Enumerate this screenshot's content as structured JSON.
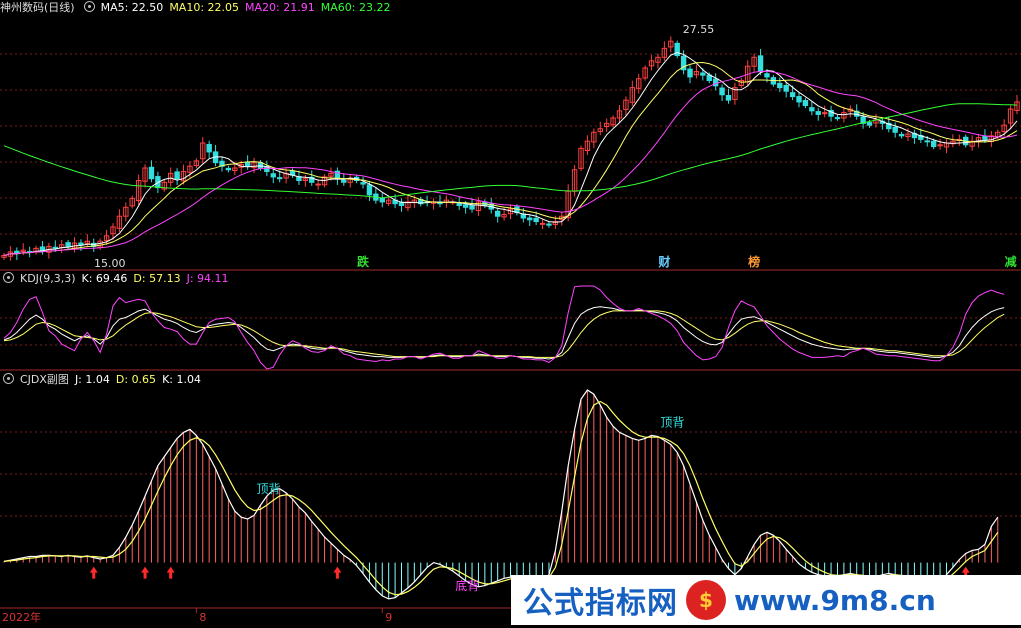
{
  "header": {
    "main": [
      {
        "text": "神州数码(日线)",
        "color": "#dddddd"
      },
      {
        "text": "MA5: 22.50",
        "color": "#ffffff"
      },
      {
        "text": "MA10: 22.05",
        "color": "#ffff66"
      },
      {
        "text": "MA20: 21.91",
        "color": "#ff44ff"
      },
      {
        "text": "MA60: 23.22",
        "color": "#33ff33"
      }
    ],
    "kdj": [
      {
        "text": "KDJ(9,3,3)",
        "color": "#dddddd"
      },
      {
        "text": "K: 69.46",
        "color": "#ffffff"
      },
      {
        "text": "D: 57.13",
        "color": "#ffff66"
      },
      {
        "text": "J: 94.11",
        "color": "#ff44ff"
      }
    ],
    "cjdx": [
      {
        "text": "CJDX副图",
        "color": "#dddddd"
      },
      {
        "text": "J: 1.04",
        "color": "#ffffff"
      },
      {
        "text": "D: 0.65",
        "color": "#ffff66"
      },
      {
        "text": "K: 1.04",
        "color": "#ffffff"
      }
    ]
  },
  "price_labels": {
    "high": "27.55",
    "low": "15.00"
  },
  "event_markers": [
    {
      "text": "跌",
      "color": "#33dd33",
      "x_index": 56
    },
    {
      "text": "财",
      "color": "#66ccff",
      "x_index": 103
    },
    {
      "text": "榜",
      "color": "#ff9933",
      "x_index": 117
    },
    {
      "text": "减",
      "color": "#33dd33",
      "x_index": 157
    }
  ],
  "cjdx_annotations": [
    {
      "text": "顶背",
      "color": "#33dddd",
      "x_index": 40,
      "value": 1.15
    },
    {
      "text": "顶背",
      "color": "#33dddd",
      "x_index": 103,
      "value": 2.25
    },
    {
      "text": "底背",
      "color": "#ff44ff",
      "x_index": 71,
      "value": -0.45
    }
  ],
  "x_axis_labels": [
    {
      "text": "2022年",
      "x_index": 0
    },
    {
      "text": "8",
      "x_index": 30
    },
    {
      "text": "9",
      "x_index": 59
    }
  ],
  "watermark": {
    "cn": "公式指标网",
    "logo": "$",
    "url": "www.9m8.cn"
  },
  "colors": {
    "up": "#ff4040",
    "down": "#33dddd",
    "ma5": "#ffffff",
    "ma10": "#ffff66",
    "ma20": "#ff44ff",
    "ma60": "#33ff33",
    "k": "#ffffff",
    "d": "#ffff66",
    "j": "#ff44ff",
    "grid": "#7a1e1e",
    "axis": "#a52a2a"
  },
  "chart_data": [
    {
      "type": "candlestick",
      "title": "神州数码(日线)",
      "ylim": [
        14.5,
        28.5
      ],
      "close": [
        15.2,
        15.4,
        15.3,
        15.5,
        15.4,
        15.6,
        15.5,
        15.7,
        15.6,
        15.8,
        15.7,
        15.9,
        15.8,
        16.0,
        15.7,
        16.0,
        16.3,
        16.8,
        17.4,
        17.9,
        18.4,
        19.4,
        20.1,
        19.5,
        19.0,
        19.3,
        19.8,
        19.5,
        19.9,
        20.2,
        20.5,
        21.5,
        21.0,
        20.4,
        20.2,
        20.0,
        20.1,
        20.3,
        20.2,
        20.4,
        20.1,
        19.9,
        19.6,
        19.5,
        19.8,
        19.7,
        19.4,
        19.5,
        19.3,
        19.2,
        19.6,
        19.8,
        19.5,
        19.3,
        19.5,
        19.4,
        19.2,
        18.6,
        18.3,
        18.2,
        18.3,
        18.1,
        18.0,
        18.2,
        18.3,
        18.1,
        18.2,
        18.2,
        18.1,
        18.3,
        18.2,
        18.0,
        17.9,
        17.8,
        18.2,
        18.0,
        17.8,
        17.4,
        17.5,
        17.8,
        17.6,
        17.3,
        17.2,
        17.1,
        17.0,
        16.9,
        17.1,
        17.4,
        18.8,
        20.0,
        21.2,
        21.6,
        22.1,
        22.3,
        22.6,
        22.9,
        23.3,
        23.9,
        24.6,
        25.1,
        25.7,
        26.1,
        26.3,
        26.8,
        27.2,
        26.4,
        25.6,
        25.2,
        25.5,
        25.3,
        25.0,
        24.7,
        24.2,
        23.9,
        24.6,
        25.0,
        25.8,
        26.3,
        25.5,
        25.2,
        24.8,
        24.6,
        24.4,
        24.1,
        23.8,
        23.6,
        23.3,
        23.1,
        23.2,
        23.0,
        22.9,
        23.2,
        23.4,
        23.0,
        22.6,
        22.5,
        22.8,
        22.6,
        22.3,
        22.1,
        21.9,
        22.0,
        21.8,
        21.7,
        21.6,
        21.3,
        21.4,
        21.5,
        21.6,
        21.7,
        21.4,
        21.6,
        21.8,
        21.7,
        21.9,
        22.1,
        22.5,
        23.4,
        23.8
      ],
      "ma_periods": [
        5,
        10,
        20,
        60
      ],
      "ma60_start": 21.5
    },
    {
      "type": "line",
      "title": "KDJ(9,3,3)",
      "ylim": [
        0,
        100
      ],
      "series": [
        {
          "name": "K",
          "values": [
            35,
            38,
            44,
            52,
            60,
            65,
            60,
            52,
            48,
            42,
            38,
            34,
            38,
            40,
            36,
            30,
            38,
            52,
            60,
            62,
            66,
            70,
            72,
            68,
            64,
            60,
            58,
            55,
            50,
            46,
            44,
            48,
            52,
            54,
            55,
            56,
            55,
            50,
            44,
            38,
            30,
            24,
            22,
            25,
            28,
            30,
            29,
            27,
            25,
            24,
            24,
            26,
            25,
            22,
            20,
            18,
            17,
            16,
            15,
            15,
            14,
            14,
            14,
            15,
            15,
            14,
            15,
            16,
            17,
            16,
            15,
            15,
            16,
            16,
            18,
            17,
            16,
            15,
            15,
            16,
            15,
            14,
            14,
            13,
            13,
            12,
            14,
            20,
            38,
            55,
            66,
            71,
            74,
            75,
            74,
            73,
            71,
            70,
            70,
            71,
            70,
            69,
            68,
            66,
            63,
            58,
            50,
            44,
            38,
            33,
            30,
            29,
            32,
            42,
            52,
            60,
            62,
            63,
            60,
            56,
            52,
            48,
            44,
            40,
            36,
            33,
            30,
            28,
            26,
            25,
            24,
            23,
            24,
            24,
            25,
            24,
            22,
            21,
            20,
            20,
            19,
            18,
            17,
            16,
            15,
            14,
            14,
            16,
            20,
            28,
            40,
            50,
            58,
            64,
            69,
            72,
            74
          ]
        },
        {
          "name": "D",
          "values": [
            34,
            35,
            38,
            42,
            48,
            54,
            56,
            55,
            52,
            48,
            44,
            40,
            39,
            38,
            37,
            35,
            36,
            40,
            47,
            53,
            58,
            63,
            67,
            68,
            67,
            65,
            63,
            60,
            57,
            54,
            51,
            50,
            50,
            51,
            52,
            53,
            54,
            53,
            50,
            46,
            41,
            36,
            32,
            29,
            28,
            28,
            28,
            28,
            27,
            26,
            25,
            25,
            25,
            24,
            22,
            21,
            20,
            19,
            18,
            17,
            16,
            15,
            15,
            15,
            15,
            15,
            15,
            15,
            16,
            16,
            16,
            16,
            16,
            16,
            16,
            16,
            16,
            16,
            16,
            16,
            15,
            15,
            15,
            14,
            14,
            14,
            14,
            16,
            23,
            33,
            44,
            53,
            60,
            65,
            68,
            70,
            70,
            70,
            70,
            70,
            70,
            70,
            70,
            69,
            67,
            64,
            59,
            54,
            49,
            44,
            39,
            36,
            35,
            38,
            43,
            49,
            54,
            57,
            58,
            58,
            56,
            54,
            51,
            48,
            44,
            41,
            38,
            35,
            32,
            30,
            28,
            27,
            26,
            25,
            25,
            25,
            24,
            23,
            22,
            22,
            21,
            20,
            19,
            18,
            17,
            16,
            16,
            16,
            17,
            21,
            27,
            35,
            43,
            50,
            56,
            62,
            66
          ]
        },
        {
          "name": "J",
          "values": [
            37,
            44,
            56,
            72,
            84,
            87,
            68,
            46,
            40,
            30,
            26,
            22,
            36,
            44,
            34,
            20,
            42,
            76,
            86,
            80,
            82,
            84,
            82,
            68,
            58,
            50,
            48,
            45,
            36,
            30,
            30,
            44,
            56,
            60,
            61,
            62,
            57,
            44,
            32,
            22,
            8,
            0,
            2,
            17,
            28,
            34,
            31,
            25,
            21,
            20,
            22,
            28,
            25,
            18,
            16,
            12,
            11,
            10,
            9,
            11,
            10,
            12,
            12,
            15,
            15,
            12,
            15,
            18,
            19,
            16,
            13,
            13,
            16,
            16,
            22,
            19,
            16,
            13,
            13,
            16,
            15,
            12,
            12,
            11,
            11,
            8,
            14,
            28,
            68,
            99,
            110,
            107,
            102,
            95,
            86,
            79,
            73,
            70,
            70,
            73,
            70,
            67,
            64,
            60,
            55,
            46,
            32,
            24,
            16,
            11,
            12,
            15,
            26,
            50,
            70,
            82,
            78,
            75,
            64,
            52,
            44,
            36,
            30,
            24,
            20,
            17,
            14,
            14,
            14,
            15,
            16,
            15,
            20,
            22,
            25,
            22,
            18,
            17,
            16,
            16,
            15,
            14,
            13,
            12,
            11,
            10,
            10,
            16,
            26,
            42,
            66,
            80,
            88,
            92,
            95,
            92,
            90
          ]
        }
      ]
    },
    {
      "type": "bar+line",
      "title": "CJDX副图",
      "ylim": [
        -0.75,
        2.85
      ],
      "histogram_colors": {
        "positive": "#ff6666",
        "negative": "#88ffff"
      },
      "signal_arrows_x_index": [
        14,
        22,
        26,
        52,
        150
      ],
      "series": [
        {
          "name": "J",
          "values": [
            0.02,
            0.04,
            0.06,
            0.08,
            0.1,
            0.1,
            0.12,
            0.12,
            0.11,
            0.1,
            0.12,
            0.1,
            0.09,
            0.11,
            0.08,
            0.06,
            0.08,
            0.12,
            0.25,
            0.42,
            0.62,
            0.85,
            1.1,
            1.35,
            1.6,
            1.75,
            1.9,
            2.05,
            2.15,
            2.2,
            2.1,
            1.95,
            1.75,
            1.55,
            1.3,
            1.05,
            0.85,
            0.75,
            0.72,
            0.78,
            0.95,
            1.1,
            1.2,
            1.22,
            1.15,
            1.05,
            0.92,
            0.82,
            0.68,
            0.55,
            0.42,
            0.32,
            0.22,
            0.12,
            0.05,
            -0.05,
            -0.18,
            -0.32,
            -0.45,
            -0.55,
            -0.6,
            -0.58,
            -0.5,
            -0.42,
            -0.32,
            -0.2,
            -0.08,
            0.0,
            -0.03,
            -0.08,
            -0.14,
            -0.22,
            -0.3,
            -0.36,
            -0.4,
            -0.38,
            -0.34,
            -0.3,
            -0.26,
            -0.24,
            -0.22,
            -0.24,
            -0.28,
            -0.3,
            -0.28,
            -0.2,
            0.2,
            0.85,
            1.6,
            2.2,
            2.7,
            2.85,
            2.78,
            2.6,
            2.4,
            2.25,
            2.15,
            2.1,
            2.05,
            2.02,
            2.05,
            2.1,
            2.08,
            2.02,
            1.95,
            1.82,
            1.6,
            1.3,
            1.0,
            0.7,
            0.45,
            0.25,
            0.05,
            -0.1,
            -0.2,
            -0.1,
            0.1,
            0.3,
            0.45,
            0.5,
            0.45,
            0.35,
            0.22,
            0.1,
            -0.02,
            -0.1,
            -0.16,
            -0.2,
            -0.22,
            -0.24,
            -0.22,
            -0.2,
            -0.18,
            -0.2,
            -0.24,
            -0.26,
            -0.24,
            -0.2,
            -0.18,
            -0.2,
            -0.22,
            -0.25,
            -0.28,
            -0.3,
            -0.32,
            -0.34,
            -0.3,
            -0.2,
            -0.08,
            0.05,
            0.15,
            0.2,
            0.22,
            0.3,
            0.6,
            0.75
          ]
        },
        {
          "name": "D",
          "values": [
            0.02,
            0.03,
            0.04,
            0.06,
            0.07,
            0.08,
            0.1,
            0.11,
            0.11,
            0.11,
            0.11,
            0.11,
            0.1,
            0.1,
            0.1,
            0.09,
            0.08,
            0.09,
            0.14,
            0.22,
            0.35,
            0.52,
            0.72,
            0.95,
            1.18,
            1.4,
            1.6,
            1.78,
            1.92,
            2.02,
            2.06,
            2.02,
            1.93,
            1.78,
            1.6,
            1.4,
            1.2,
            1.04,
            0.92,
            0.86,
            0.88,
            0.95,
            1.03,
            1.1,
            1.12,
            1.1,
            1.04,
            0.96,
            0.86,
            0.74,
            0.62,
            0.5,
            0.39,
            0.28,
            0.18,
            0.08,
            -0.04,
            -0.16,
            -0.29,
            -0.4,
            -0.49,
            -0.53,
            -0.52,
            -0.48,
            -0.41,
            -0.32,
            -0.21,
            -0.11,
            -0.07,
            -0.08,
            -0.1,
            -0.15,
            -0.21,
            -0.27,
            -0.32,
            -0.35,
            -0.35,
            -0.33,
            -0.3,
            -0.27,
            -0.25,
            -0.24,
            -0.25,
            -0.27,
            -0.28,
            -0.25,
            -0.08,
            0.3,
            0.85,
            1.42,
            1.98,
            2.38,
            2.6,
            2.66,
            2.6,
            2.47,
            2.35,
            2.25,
            2.16,
            2.1,
            2.07,
            2.07,
            2.07,
            2.05,
            2.0,
            1.93,
            1.8,
            1.6,
            1.34,
            1.06,
            0.8,
            0.56,
            0.35,
            0.15,
            -0.02,
            -0.06,
            0.02,
            0.15,
            0.28,
            0.39,
            0.43,
            0.41,
            0.34,
            0.24,
            0.13,
            0.03,
            -0.05,
            -0.11,
            -0.16,
            -0.2,
            -0.21,
            -0.21,
            -0.2,
            -0.2,
            -0.21,
            -0.23,
            -0.24,
            -0.23,
            -0.21,
            -0.2,
            -0.21,
            -0.23,
            -0.25,
            -0.27,
            -0.29,
            -0.31,
            -0.31,
            -0.27,
            -0.19,
            -0.09,
            0.02,
            0.1,
            0.15,
            0.2,
            0.35,
            0.5
          ]
        }
      ]
    }
  ]
}
